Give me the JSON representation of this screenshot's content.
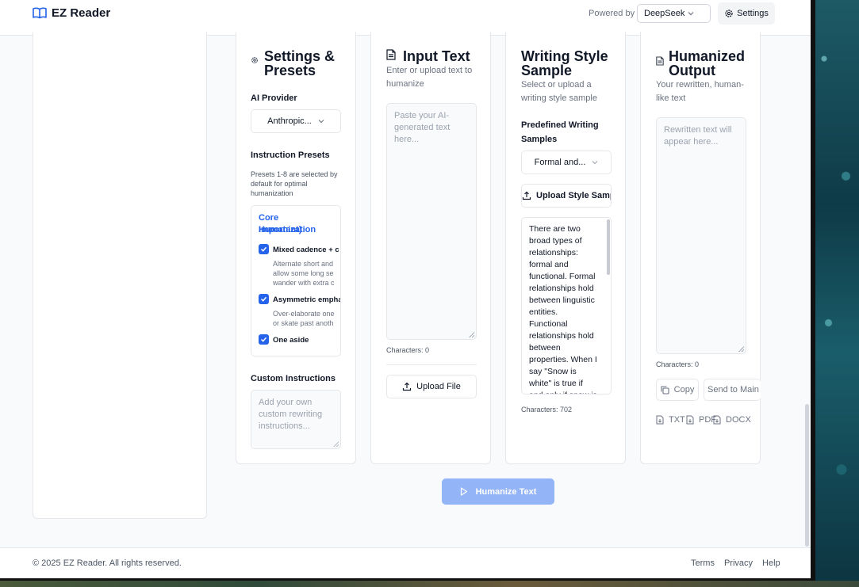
{
  "header": {
    "app_title": "EZ Reader",
    "powered_by": "Powered by",
    "provider_value": "DeepSeek",
    "settings_label": "Settings"
  },
  "settings_panel": {
    "title_line1": "Settings &",
    "title_line2": "Presets",
    "ai_provider_label": "AI Provider",
    "ai_provider_value": "Anthropic...",
    "instruction_presets_label": "Instruction Presets",
    "presets_note_lines": [
      "Presets 1-8 are selected by",
      "default for optimal",
      "humanization"
    ],
    "preset_group_lines": [
      "Core Humanization",
      "Important)"
    ],
    "presets": [
      {
        "label": "Mixed cadence + c",
        "desc_lines": [
          "Alternate short and",
          "allow some long se",
          "wander with extra c"
        ],
        "checked": true
      },
      {
        "label": "Asymmetric empha",
        "desc_lines": [
          "Over-elaborate one",
          "or skate past anoth"
        ],
        "checked": true
      },
      {
        "label": "One aside",
        "desc_lines": [],
        "checked": true
      }
    ],
    "custom_instructions_label": "Custom Instructions",
    "custom_instructions_placeholder": "Add your own custom rewriting instructions..."
  },
  "input_panel": {
    "title": "Input Text",
    "subtitle": "Enter or upload text to humanize",
    "placeholder": "Paste your AI-generated text here...",
    "char_count": "Characters: 0",
    "upload_label": "Upload File"
  },
  "style_panel": {
    "title_line1": "Writing Style",
    "title_line2": "Sample",
    "subtitle": "Select or upload a writing style sample",
    "predefined_label": "Predefined Writing Samples",
    "predefined_value": "Formal and...",
    "upload_label": "Upload Style Sample",
    "sample_text": "There are two broad types of relationships: formal and functional. Formal relationships hold between linguistic entities. Functional relationships hold between properties. When I say \"Snow is white\" is true if and only if snow is white, the relationship",
    "char_count": "Characters: 702"
  },
  "output_panel": {
    "title_line1": "Humanized",
    "title_line2": "Output",
    "subtitle": "Your rewritten, human-like text",
    "placeholder": "Rewritten text will appear here...",
    "char_count": "Characters: 0",
    "copy_label": "Copy",
    "send_label": "Send to Main",
    "txt_label": "TXT",
    "pdf_label": "PDF",
    "docx_label": "DOCX"
  },
  "humanize_button_label": "Humanize Text",
  "footer": {
    "copyright": "© 2025 EZ Reader. All rights reserved.",
    "links": [
      "Terms",
      "Privacy",
      "Help"
    ]
  },
  "colors": {
    "accent": "#2563eb",
    "disabled_button": "#93b4f6",
    "page_bg": "#f8fafc"
  }
}
